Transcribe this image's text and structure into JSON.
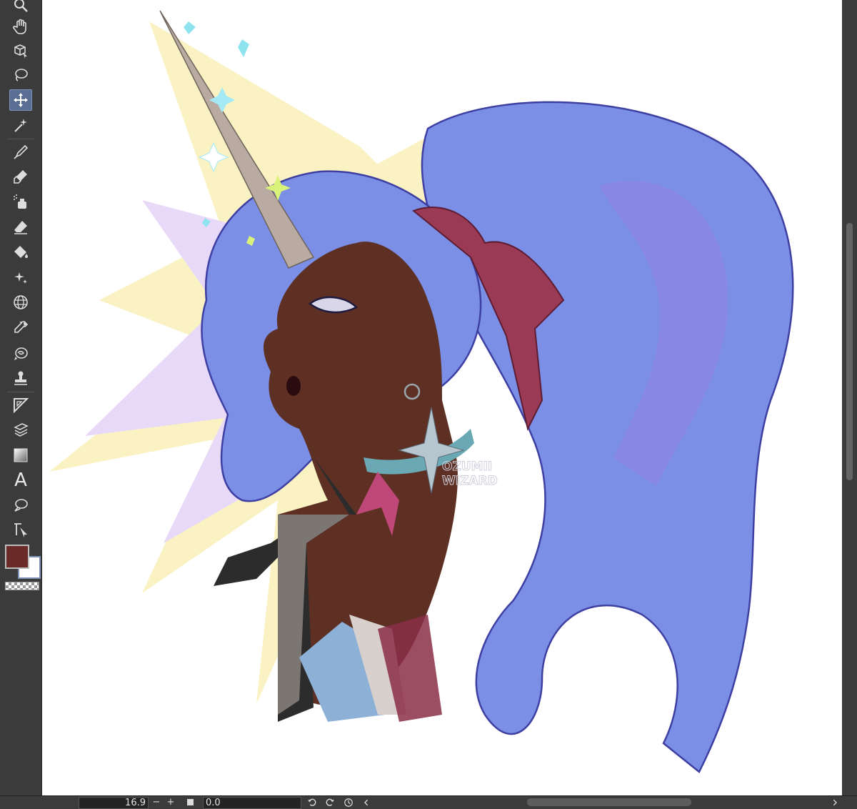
{
  "toolbar": {
    "tools": [
      "zoom-tool",
      "hand-tool",
      "rotate-tool",
      "lasso-selection-tool",
      "move-tool",
      "auto-select-tool",
      "pen-tool",
      "marker-tool",
      "airbrush-tool",
      "eraser-tool",
      "fill-tool",
      "decoration-tool",
      "grid-tool",
      "eyedropper-tool",
      "blend-tool",
      "stamp-tool",
      "ruler-tool",
      "layer-move-tool",
      "gradient-tool",
      "text-tool",
      "balloon-tool",
      "correct-line-tool"
    ],
    "active_tool": "move-tool",
    "text_tool_glyph": "A"
  },
  "colors": {
    "main_color": "#6a2a27",
    "sub_color": "#ffffff",
    "accent": "#5a6d92"
  },
  "artwork": {
    "watermark_line1": "OZUMII",
    "watermark_line2": "WIZARD"
  },
  "statusbar": {
    "zoom_value": "16.9",
    "zoom_out_label": "−",
    "zoom_in_label": "+",
    "angle_value": "0.0"
  }
}
